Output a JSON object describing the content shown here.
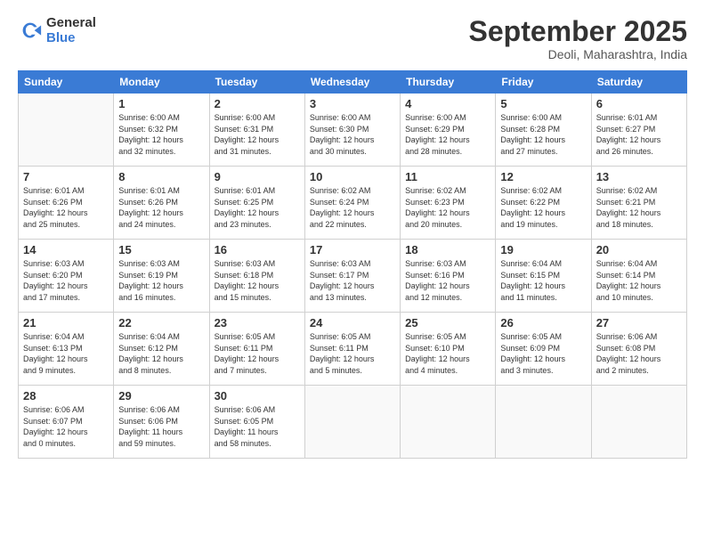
{
  "logo": {
    "general": "General",
    "blue": "Blue"
  },
  "title": "September 2025",
  "location": "Deoli, Maharashtra, India",
  "weekdays": [
    "Sunday",
    "Monday",
    "Tuesday",
    "Wednesday",
    "Thursday",
    "Friday",
    "Saturday"
  ],
  "weeks": [
    [
      {
        "day": "",
        "info": ""
      },
      {
        "day": "1",
        "info": "Sunrise: 6:00 AM\nSunset: 6:32 PM\nDaylight: 12 hours\nand 32 minutes."
      },
      {
        "day": "2",
        "info": "Sunrise: 6:00 AM\nSunset: 6:31 PM\nDaylight: 12 hours\nand 31 minutes."
      },
      {
        "day": "3",
        "info": "Sunrise: 6:00 AM\nSunset: 6:30 PM\nDaylight: 12 hours\nand 30 minutes."
      },
      {
        "day": "4",
        "info": "Sunrise: 6:00 AM\nSunset: 6:29 PM\nDaylight: 12 hours\nand 28 minutes."
      },
      {
        "day": "5",
        "info": "Sunrise: 6:00 AM\nSunset: 6:28 PM\nDaylight: 12 hours\nand 27 minutes."
      },
      {
        "day": "6",
        "info": "Sunrise: 6:01 AM\nSunset: 6:27 PM\nDaylight: 12 hours\nand 26 minutes."
      }
    ],
    [
      {
        "day": "7",
        "info": "Sunrise: 6:01 AM\nSunset: 6:26 PM\nDaylight: 12 hours\nand 25 minutes."
      },
      {
        "day": "8",
        "info": "Sunrise: 6:01 AM\nSunset: 6:26 PM\nDaylight: 12 hours\nand 24 minutes."
      },
      {
        "day": "9",
        "info": "Sunrise: 6:01 AM\nSunset: 6:25 PM\nDaylight: 12 hours\nand 23 minutes."
      },
      {
        "day": "10",
        "info": "Sunrise: 6:02 AM\nSunset: 6:24 PM\nDaylight: 12 hours\nand 22 minutes."
      },
      {
        "day": "11",
        "info": "Sunrise: 6:02 AM\nSunset: 6:23 PM\nDaylight: 12 hours\nand 20 minutes."
      },
      {
        "day": "12",
        "info": "Sunrise: 6:02 AM\nSunset: 6:22 PM\nDaylight: 12 hours\nand 19 minutes."
      },
      {
        "day": "13",
        "info": "Sunrise: 6:02 AM\nSunset: 6:21 PM\nDaylight: 12 hours\nand 18 minutes."
      }
    ],
    [
      {
        "day": "14",
        "info": "Sunrise: 6:03 AM\nSunset: 6:20 PM\nDaylight: 12 hours\nand 17 minutes."
      },
      {
        "day": "15",
        "info": "Sunrise: 6:03 AM\nSunset: 6:19 PM\nDaylight: 12 hours\nand 16 minutes."
      },
      {
        "day": "16",
        "info": "Sunrise: 6:03 AM\nSunset: 6:18 PM\nDaylight: 12 hours\nand 15 minutes."
      },
      {
        "day": "17",
        "info": "Sunrise: 6:03 AM\nSunset: 6:17 PM\nDaylight: 12 hours\nand 13 minutes."
      },
      {
        "day": "18",
        "info": "Sunrise: 6:03 AM\nSunset: 6:16 PM\nDaylight: 12 hours\nand 12 minutes."
      },
      {
        "day": "19",
        "info": "Sunrise: 6:04 AM\nSunset: 6:15 PM\nDaylight: 12 hours\nand 11 minutes."
      },
      {
        "day": "20",
        "info": "Sunrise: 6:04 AM\nSunset: 6:14 PM\nDaylight: 12 hours\nand 10 minutes."
      }
    ],
    [
      {
        "day": "21",
        "info": "Sunrise: 6:04 AM\nSunset: 6:13 PM\nDaylight: 12 hours\nand 9 minutes."
      },
      {
        "day": "22",
        "info": "Sunrise: 6:04 AM\nSunset: 6:12 PM\nDaylight: 12 hours\nand 8 minutes."
      },
      {
        "day": "23",
        "info": "Sunrise: 6:05 AM\nSunset: 6:11 PM\nDaylight: 12 hours\nand 7 minutes."
      },
      {
        "day": "24",
        "info": "Sunrise: 6:05 AM\nSunset: 6:11 PM\nDaylight: 12 hours\nand 5 minutes."
      },
      {
        "day": "25",
        "info": "Sunrise: 6:05 AM\nSunset: 6:10 PM\nDaylight: 12 hours\nand 4 minutes."
      },
      {
        "day": "26",
        "info": "Sunrise: 6:05 AM\nSunset: 6:09 PM\nDaylight: 12 hours\nand 3 minutes."
      },
      {
        "day": "27",
        "info": "Sunrise: 6:06 AM\nSunset: 6:08 PM\nDaylight: 12 hours\nand 2 minutes."
      }
    ],
    [
      {
        "day": "28",
        "info": "Sunrise: 6:06 AM\nSunset: 6:07 PM\nDaylight: 12 hours\nand 0 minutes."
      },
      {
        "day": "29",
        "info": "Sunrise: 6:06 AM\nSunset: 6:06 PM\nDaylight: 11 hours\nand 59 minutes."
      },
      {
        "day": "30",
        "info": "Sunrise: 6:06 AM\nSunset: 6:05 PM\nDaylight: 11 hours\nand 58 minutes."
      },
      {
        "day": "",
        "info": ""
      },
      {
        "day": "",
        "info": ""
      },
      {
        "day": "",
        "info": ""
      },
      {
        "day": "",
        "info": ""
      }
    ]
  ]
}
